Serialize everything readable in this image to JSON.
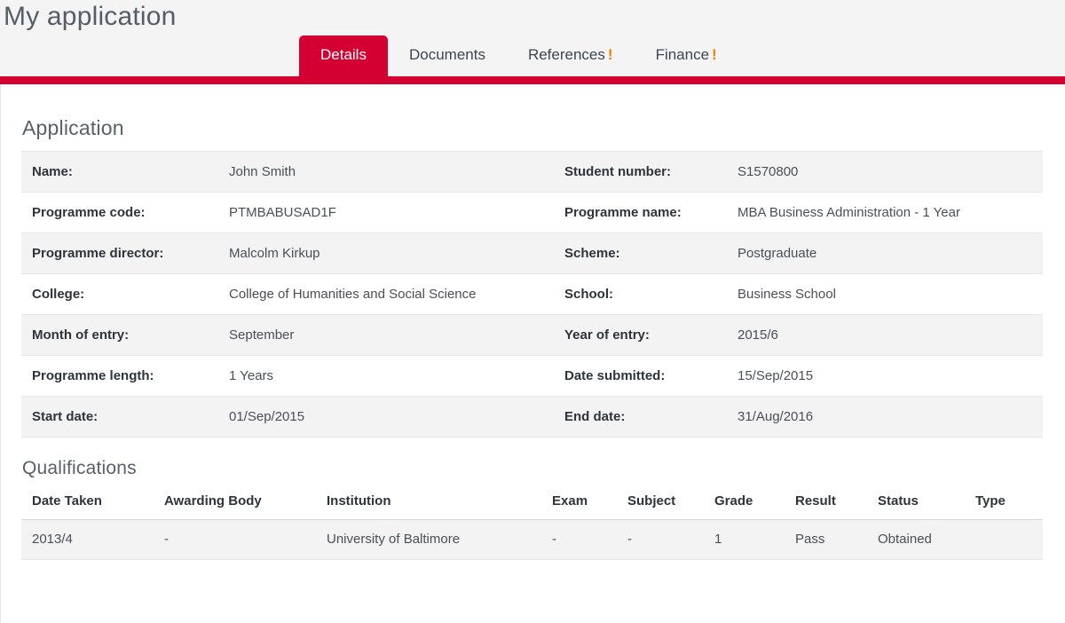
{
  "header": {
    "app_title": "My application",
    "accent_color": "#d50032",
    "warning_color": "#f07d00",
    "tabs": [
      {
        "label": "Details",
        "active": true,
        "warning": ""
      },
      {
        "label": "Documents",
        "active": false,
        "warning": ""
      },
      {
        "label": "References",
        "active": false,
        "warning": "!"
      },
      {
        "label": "Finance",
        "active": false,
        "warning": "!"
      }
    ]
  },
  "application": {
    "section_title": "Application",
    "rows": [
      {
        "label_left": "Name:",
        "value_left": "John Smith",
        "label_right": "Student number:",
        "value_right": "S1570800"
      },
      {
        "label_left": "Programme code:",
        "value_left": "PTMBABUSAD1F",
        "label_right": "Programme name:",
        "value_right": "MBA Business Administration - 1 Year"
      },
      {
        "label_left": "Programme director:",
        "value_left": "Malcolm Kirkup",
        "label_right": "Scheme:",
        "value_right": "Postgraduate"
      },
      {
        "label_left": "College:",
        "value_left": "College of Humanities and Social Science",
        "label_right": "School:",
        "value_right": "Business School"
      },
      {
        "label_left": "Month of entry:",
        "value_left": "September",
        "label_right": "Year of entry:",
        "value_right": "2015/6"
      },
      {
        "label_left": "Programme length:",
        "value_left": "1 Years",
        "label_right": "Date submitted:",
        "value_right": "15/Sep/2015"
      },
      {
        "label_left": "Start date:",
        "value_left": "01/Sep/2015",
        "label_right": "End date:",
        "value_right": "31/Aug/2016"
      }
    ]
  },
  "qualifications": {
    "section_title": "Qualifications",
    "columns": [
      "Date Taken",
      "Awarding Body",
      "Institution",
      "Exam",
      "Subject",
      "Grade",
      "Result",
      "Status",
      "Type"
    ],
    "rows": [
      {
        "date_taken": "2013/4",
        "awarding_body": "-",
        "institution": "University of Baltimore",
        "exam": "-",
        "subject": "-",
        "grade": "1",
        "result": "Pass",
        "status": "Obtained",
        "type": ""
      }
    ]
  }
}
